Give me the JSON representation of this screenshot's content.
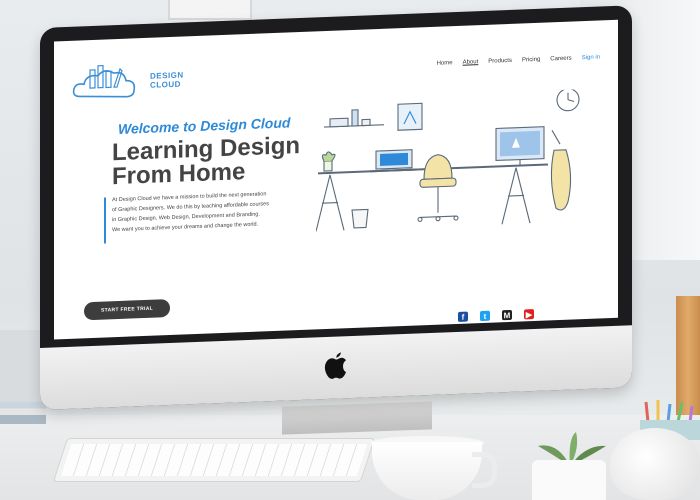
{
  "site": {
    "logo_text_line1": "DESIGN",
    "logo_text_line2": "CLOUD",
    "nav": [
      {
        "label": "Home"
      },
      {
        "label": "About"
      },
      {
        "label": "Products"
      },
      {
        "label": "Pricing"
      },
      {
        "label": "Careers"
      },
      {
        "label": "Sign in"
      }
    ],
    "welcome": "Welcome to Design Cloud",
    "headline_line1": "Learning Design",
    "headline_line2": "From Home",
    "paragraph_lines": [
      "At Design Cloud we have a mission to build the next generation",
      "of Graphic Designers. We do this by teaching affordable courses",
      "in Graphic Design, Web Design, Development and Branding.",
      "We want you to achieve your dreams and change the world."
    ],
    "cta_label": "START FREE TRIAL",
    "social": [
      {
        "icon": "facebook-icon",
        "glyph": "f",
        "color": "#1c4fa0"
      },
      {
        "icon": "twitter-icon",
        "glyph": "t",
        "color": "#1da1f2"
      },
      {
        "icon": "medium-icon",
        "glyph": "M",
        "color": "#222222"
      },
      {
        "icon": "youtube-icon",
        "glyph": "▶",
        "color": "#e02020"
      }
    ],
    "accent_color": "#2e8ad8"
  }
}
